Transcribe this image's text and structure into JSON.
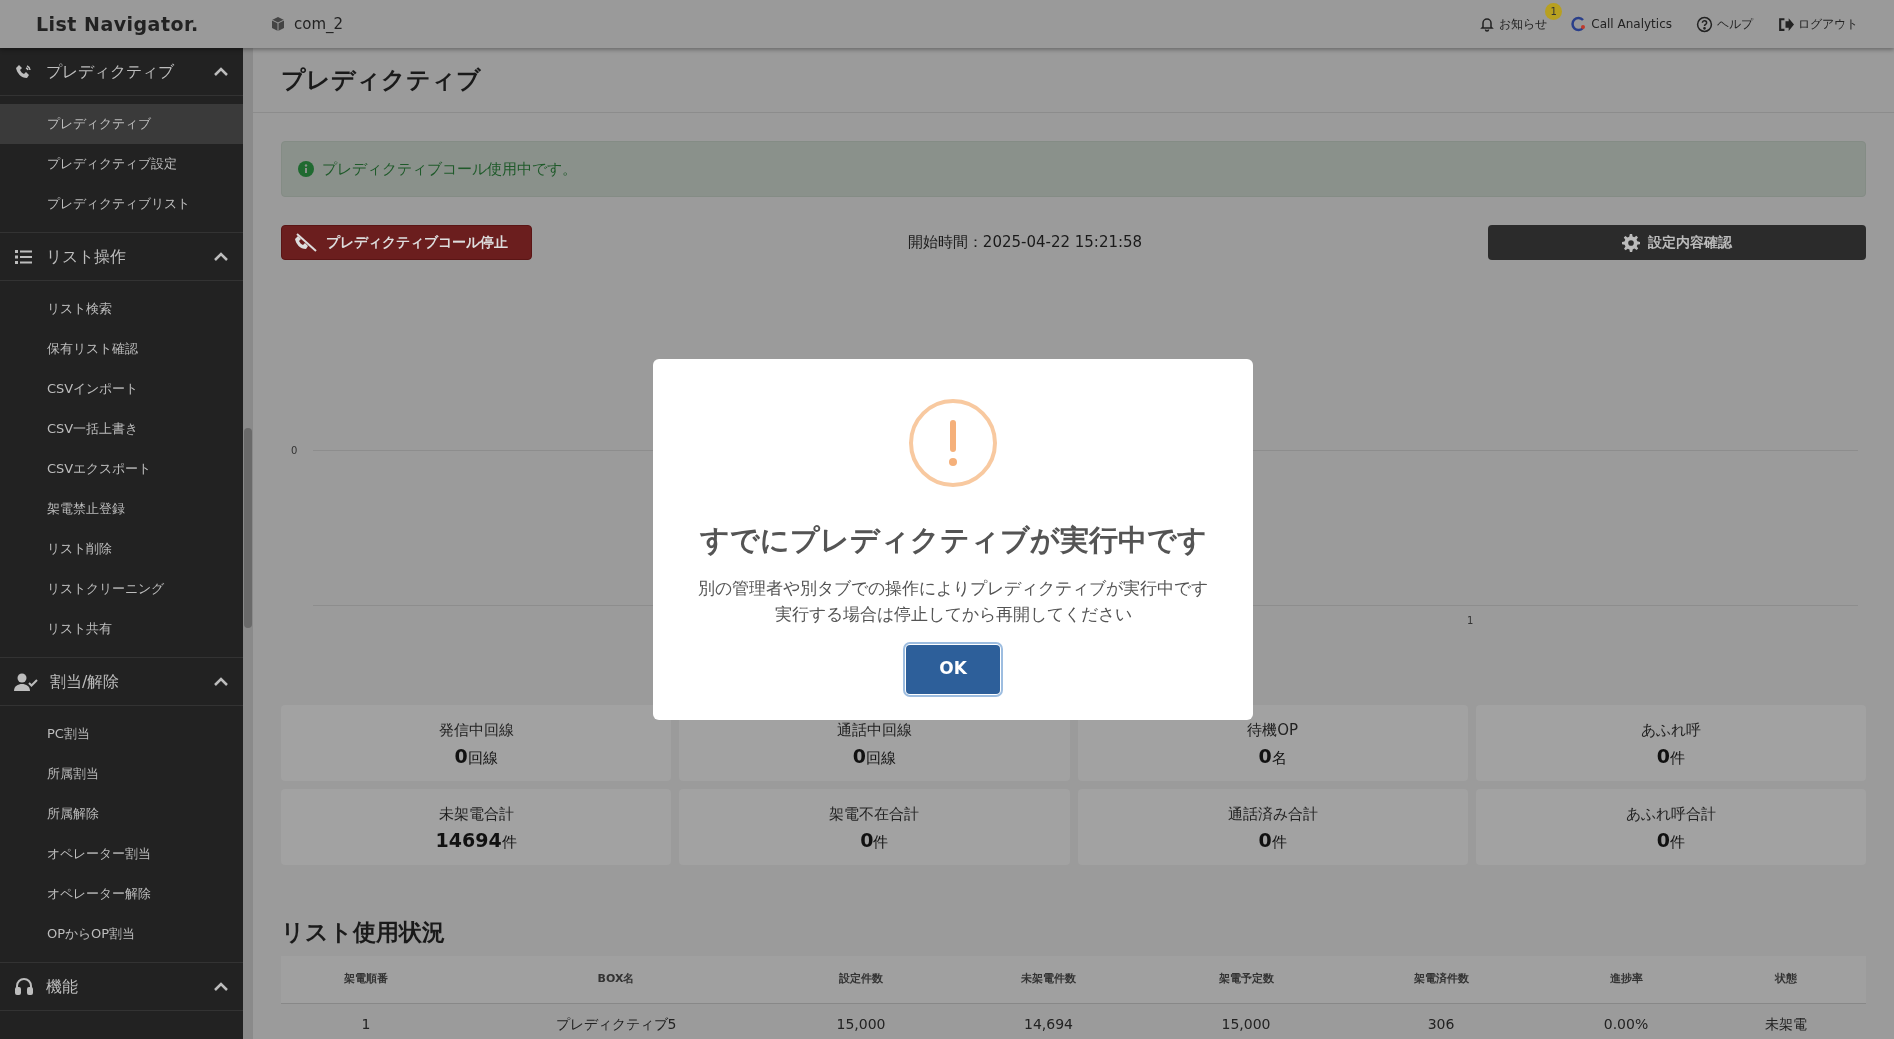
{
  "header": {
    "logo": "List Navigator.",
    "company": "com_2",
    "nav": [
      {
        "kind": "bell",
        "label": "お知らせ",
        "badge": "1"
      },
      {
        "kind": "analytics",
        "label": "Call Analytics"
      },
      {
        "kind": "help",
        "label": "ヘルプ"
      },
      {
        "kind": "logout",
        "label": "ログアウト"
      }
    ]
  },
  "sidebar": {
    "groups": [
      {
        "kind": "phone",
        "label": "プレディクティブ",
        "expanded": true,
        "items": [
          {
            "label": "プレディクティブ",
            "selected": true
          },
          {
            "label": "プレディクティブ設定",
            "selected": false
          },
          {
            "label": "プレディクティブリスト",
            "selected": false
          }
        ]
      },
      {
        "kind": "list",
        "label": "リスト操作",
        "expanded": true,
        "items": [
          {
            "label": "リスト検索",
            "selected": false
          },
          {
            "label": "保有リスト確認",
            "selected": false
          },
          {
            "label": "CSVインポート",
            "selected": false
          },
          {
            "label": "CSV一括上書き",
            "selected": false
          },
          {
            "label": "CSVエクスポート",
            "selected": false
          },
          {
            "label": "架電禁止登録",
            "selected": false
          },
          {
            "label": "リスト削除",
            "selected": false
          },
          {
            "label": "リストクリーニング",
            "selected": false
          },
          {
            "label": "リスト共有",
            "selected": false
          }
        ]
      },
      {
        "kind": "user",
        "label": "割当/解除",
        "expanded": true,
        "items": [
          {
            "label": "PC割当",
            "selected": false
          },
          {
            "label": "所属割当",
            "selected": false
          },
          {
            "label": "所属解除",
            "selected": false
          },
          {
            "label": "オペレーター割当",
            "selected": false
          },
          {
            "label": "オペレーター解除",
            "selected": false
          },
          {
            "label": "OPからOP割当",
            "selected": false
          }
        ]
      },
      {
        "kind": "headset",
        "label": "機能",
        "expanded": true
      }
    ]
  },
  "page": {
    "title": "プレディクティブ",
    "alert": "プレディクティブコール使用中です。",
    "stop_button": "プレディクティブコール停止",
    "start_time": "開始時間：2025-04-22 15:21:58",
    "settings_button": "設定内容確認",
    "chart": {
      "y_tick": "0",
      "x_tick": "1"
    },
    "stats": [
      {
        "label": "発信中回線",
        "value": "0",
        "unit": "回線"
      },
      {
        "label": "通話中回線",
        "value": "0",
        "unit": "回線"
      },
      {
        "label": "待機OP",
        "value": "0",
        "unit": "名"
      },
      {
        "label": "あふれ呼",
        "value": "0",
        "unit": "件"
      },
      {
        "label": "未架電合計",
        "value": "14694",
        "unit": "件"
      },
      {
        "label": "架電不在合計",
        "value": "0",
        "unit": "件"
      },
      {
        "label": "通話済み合計",
        "value": "0",
        "unit": "件"
      },
      {
        "label": "あふれ呼合計",
        "value": "0",
        "unit": "件"
      }
    ],
    "list_title": "リスト使用状況",
    "table": {
      "columns": [
        "架電順番",
        "BOX名",
        "設定件数",
        "未架電件数",
        "架電予定数",
        "架電済件数",
        "進捗率",
        "状態"
      ],
      "rows": [
        [
          "1",
          "プレディクティブ5",
          "15,000",
          "14,694",
          "15,000",
          "306",
          "0.00%",
          "未架電"
        ]
      ]
    }
  },
  "dialog": {
    "title": "すでにプレディクティブが実行中です",
    "lines": [
      "別の管理者や別タブでの操作によりプレディクティブが実行中です",
      "実行する場合は停止してから再開してください"
    ],
    "ok": "OK"
  }
}
